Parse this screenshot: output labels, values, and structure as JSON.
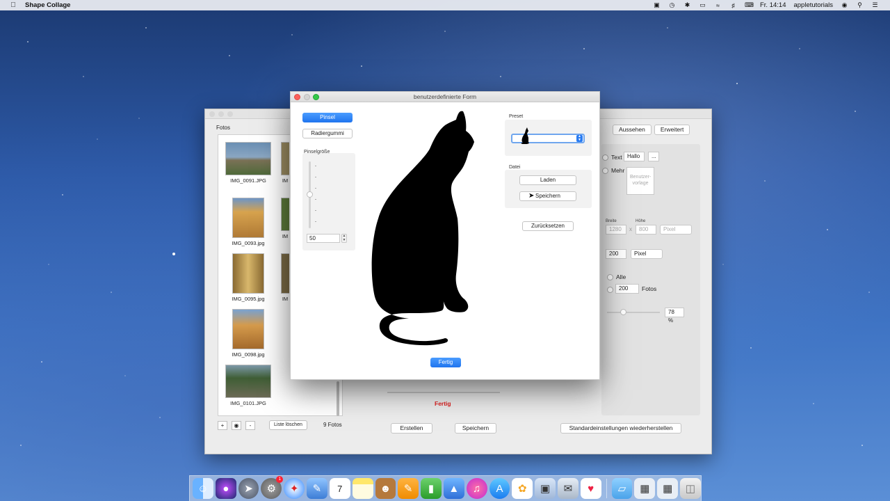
{
  "menubar": {
    "app_name": "Shape Collage",
    "clock": "Fr. 14:14",
    "user": "appletutorials",
    "icons": [
      "apple-icon",
      "lock-icon",
      "time-machine-icon",
      "bluetooth-icon",
      "airplay-icon",
      "wifi-icon",
      "volume-icon",
      "keyboard-icon",
      "user-icon",
      "spotlight-icon",
      "notification-center-icon"
    ]
  },
  "main_window": {
    "fotos_label": "Fotos",
    "photos": [
      {
        "name": "IMG_0091.JPG",
        "color": "#6a8fb3"
      },
      {
        "name": "IMG_0093.jpg",
        "color": "#c8923e"
      },
      {
        "name": "IMG_0095.jpg",
        "color": "#c4a052"
      },
      {
        "name": "IMG_0098.jpg",
        "color": "#d39a4d"
      },
      {
        "name": "IMG_0101.JPG",
        "color": "#4d6b3a"
      }
    ],
    "partial_labels": [
      "IM",
      "IM",
      "IM"
    ],
    "toolbar": {
      "add": "+",
      "remove": "-",
      "clear_label": "Liste löschen",
      "count": "9 Fotos"
    },
    "tabs": [
      "Aussehen",
      "Erweitert"
    ],
    "options": {
      "text_label": "Text",
      "text_value": "Hallo",
      "more_button": "...",
      "mehr_label": "Mehr",
      "template_placeholder": "Benutzer-vorlage",
      "breite_label": "Breite",
      "hoehe_label": "Höhe",
      "breite_value": "1280",
      "x_sep": "x",
      "hoehe_value": "800",
      "unit_1": "Pixel",
      "size_value": "200",
      "unit_2": "Pixel",
      "alle_label": "Alle",
      "fotos_count_value": "200",
      "fotos_count_label": "Fotos",
      "zoom_value": "78 %"
    },
    "status_text": "Fertig",
    "buttons": {
      "create": "Erstellen",
      "save": "Speichern",
      "reset_defaults": "Standardeinstellungen wiederherstellen"
    }
  },
  "dialog": {
    "title": "benutzerdefinierte Form",
    "brush_button": "Pinsel",
    "eraser_button": "Radiergummi",
    "brush_size_label": "Pinselgröße",
    "brush_size_value": "50",
    "preset_label": "Preset",
    "file_label": "Datei",
    "load_button": "Laden",
    "save_button": "Speichern",
    "reset_button": "Zurücksetzen",
    "done_button": "Fertig"
  },
  "dock": {
    "icons": [
      "finder-icon",
      "siri-icon",
      "launchpad-icon",
      "system-preferences-icon",
      "safari-icon",
      "preview-icon",
      "calendar-icon",
      "notes-icon",
      "contacts-icon",
      "pages-icon",
      "numbers-icon",
      "keynote-icon",
      "itunes-icon",
      "app-store-icon",
      "photos-icon",
      "image-capture-icon",
      "mail-icon",
      "shape-collage-icon",
      "folder-icon",
      "downloads-icon",
      "launcher-icon",
      "trash-icon"
    ],
    "badge": "1",
    "calendar_day": "7"
  }
}
